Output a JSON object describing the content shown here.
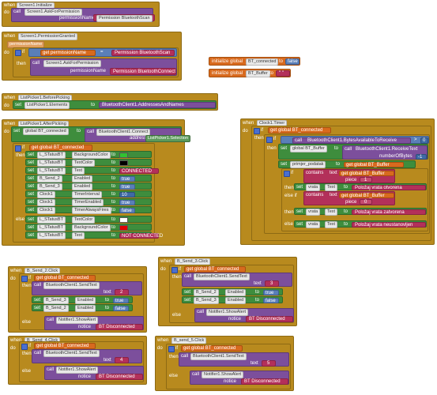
{
  "init": {
    "when": "when",
    "event": "Screen1.Initialize",
    "do": "do",
    "call": "call",
    "method": "Screen1.AskForPermission",
    "param": "permissionName",
    "value": "Permission BluetoothScan"
  },
  "perm": {
    "when": "when",
    "event": "Screen1.PermissionGranted",
    "param": "permissionName",
    "do": "do",
    "if": "if",
    "get": "get permissionName",
    "eq": "=",
    "perm_value": "Permission BluetoothScan",
    "then": "then",
    "call": "call",
    "method": "Screen1.AskForPermission",
    "arg": "permissionName",
    "arg_value": "Permission BluetoothConnect"
  },
  "globals": {
    "init_label": "initialize global",
    "bt_connected": "BT_connected",
    "bt_buffer": "BT_Buffer",
    "to": "to",
    "false": "false",
    "empty_text": "\" \""
  },
  "before": {
    "when": "when",
    "event": "ListPicker1.BeforePicking",
    "do": "do",
    "set": "set",
    "prop": "ListPicker1.Elements",
    "to": "to",
    "method": "BluetoothClient1.AddressesAndNames"
  },
  "after": {
    "when": "when",
    "event": "ListPicker1.AfterPicking",
    "do": "do",
    "set": "set",
    "var": "global BT_connected",
    "to": "to",
    "call": "call",
    "method": "BluetoothClient1.Connect",
    "address": "address",
    "selection": "ListPicker1.Selection",
    "if": "if",
    "get": "get global BT_connected",
    "then": "then",
    "else": "else",
    "then_rows": [
      {
        "set": "set",
        "obj": "L_STatusBT",
        "prop": "BackgroundColor",
        "to": "to",
        "color": "#31c231"
      },
      {
        "set": "set",
        "obj": "L_STatusBT",
        "prop": "TextColor",
        "to": "to",
        "color": "#000000"
      },
      {
        "set": "set",
        "obj": "L_STatusBT",
        "prop": "Text",
        "to": "to",
        "value": "CONNECTED"
      },
      {
        "set": "set",
        "obj": "B_Send_2",
        "prop": "Enabled",
        "to": "to",
        "value": "true"
      },
      {
        "set": "set",
        "obj": "B_Send_3",
        "prop": "Enabled",
        "to": "to",
        "value": "true"
      },
      {
        "set": "set",
        "obj": "Clock1",
        "prop": "TimerInterval",
        "to": "to",
        "value": "10"
      },
      {
        "set": "set",
        "obj": "Clock1",
        "prop": "TimerEnabled",
        "to": "to",
        "value": "true"
      },
      {
        "set": "set",
        "obj": "Clock1",
        "prop": "TimerAlwaysFires",
        "to": "to",
        "value": "false"
      }
    ],
    "else_rows": [
      {
        "set": "set",
        "obj": "L_STatusBT",
        "prop": "TextColor",
        "to": "to",
        "color": "#ffffff"
      },
      {
        "set": "set",
        "obj": "L_STatusBT",
        "prop": "BackgroundColor",
        "to": "to",
        "color": "#e00000"
      },
      {
        "set": "set",
        "obj": "L_STatusBT",
        "prop": "Text",
        "to": "to",
        "value": "NOT CONNECTED"
      }
    ]
  },
  "timer": {
    "when": "when",
    "event": "Clock1.Timer",
    "do": "do",
    "if": "if",
    "get": "get global BT_connected",
    "then": "then",
    "call": "call",
    "bytes": "BluetoothClient1.BytesAvailableToReceive",
    "gt": ">",
    "zero": "0",
    "set": "set",
    "var": "global BT_Buffer",
    "to": "to",
    "receive": "BluetoothClient1.ReceiveText",
    "nbytes": "numberOfBytes",
    "minus1": "-1",
    "join_set": "set",
    "join_var": "primjer_podatak",
    "join_to": "to",
    "join_get": "get global BT_Buffer",
    "contains": "contains",
    "text": "text",
    "piece": "piece",
    "piece1": "1",
    "piece0": "0",
    "else_if": "else if",
    "else": "else",
    "status1": "Položaj vrata otvorena",
    "status2": "Položaj vrata zatvorena",
    "status3": "Položaj vrata neustanovljen",
    "vrata": "vrata",
    "vrata_text": "Text"
  },
  "send2": {
    "when": "when",
    "event": "B_Send_2.Click",
    "do": "do",
    "if": "if",
    "get": "get global BT_connected",
    "then": "then",
    "call": "call",
    "method": "BluetoothClient1.SendText",
    "text": "text",
    "value": "2",
    "set": "set",
    "b3": "B_Send_3",
    "b2": "B_Send_2",
    "enabled": "Enabled",
    "to": "to",
    "true": "true",
    "false": "false",
    "else": "else",
    "notifier": "Notifier1.ShowAlert",
    "notice": "notice",
    "alert": "BT Disconnected"
  },
  "send3": {
    "when": "when",
    "event": "B_Send_3.Click",
    "do": "do",
    "if": "if",
    "get": "get global BT_connected",
    "then": "then",
    "call": "call",
    "method": "BluetoothClient1.SendText",
    "text": "text",
    "value": "3",
    "set": "set",
    "b2": "B_Send_2",
    "b3": "B_Send_3",
    "enabled": "Enabled",
    "to": "to",
    "true": "true",
    "false": "false",
    "else": "else",
    "notifier": "Notifier1.ShowAlert",
    "notice": "notice",
    "alert": "BT Disconnected"
  },
  "send4": {
    "when": "when",
    "event": "B_Send_4.Click",
    "do": "do",
    "if": "if",
    "get": "get global BT_connected",
    "then": "then",
    "call": "call",
    "method": "BluetoothClient1.SendText",
    "text": "text",
    "value": "4",
    "else": "else",
    "notifier": "Notifier1.ShowAlert",
    "notice": "notice",
    "alert": "BT Disconnected"
  },
  "send5": {
    "when": "when",
    "event": "B_send_5.Click",
    "do": "do",
    "if": "if",
    "get": "get global BT_connected",
    "then": "then",
    "call": "call",
    "method": "BluetoothClient1.SendText",
    "text": "text",
    "value": "5",
    "else": "else",
    "notifier": "Notifier1.ShowAlert",
    "notice": "notice",
    "alert": "BT Disconnected"
  }
}
